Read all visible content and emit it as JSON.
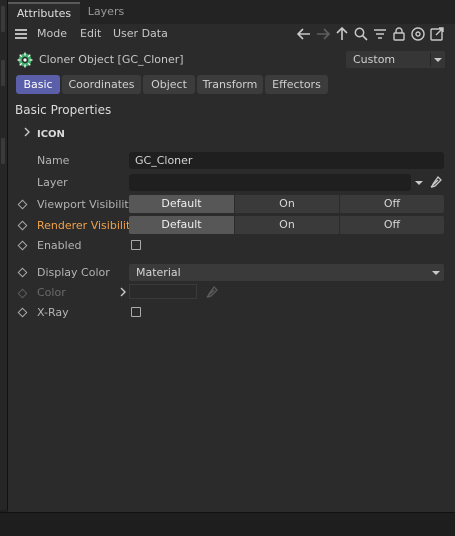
{
  "tabs": [
    {
      "label": "Attributes",
      "active": true
    },
    {
      "label": "Layers",
      "active": false
    }
  ],
  "menu": [
    "Mode",
    "Edit",
    "User Data"
  ],
  "object": {
    "title": "Cloner Object [GC_Cloner]",
    "preset": "Custom"
  },
  "subtabs": [
    {
      "label": "Basic",
      "active": true
    },
    {
      "label": "Coordinates",
      "active": false
    },
    {
      "label": "Object",
      "active": false
    },
    {
      "label": "Transform",
      "active": false
    },
    {
      "label": "Effectors",
      "active": false
    }
  ],
  "section_title": "Basic Properties",
  "group_title": "ICON",
  "fields": {
    "name_label": "Name",
    "name_value": "GC_Cloner",
    "layer_label": "Layer",
    "layer_value": "",
    "viewport_label": "Viewport Visibility",
    "renderer_label": "Renderer Visibility",
    "visibility_options": [
      "Default",
      "On",
      "Off"
    ],
    "viewport_selected": "Default",
    "renderer_selected": "Default",
    "enabled_label": "Enabled",
    "enabled_checked": false,
    "display_color_label": "Display Color",
    "display_color_value": "Material",
    "color_label": "Color",
    "xray_label": "X-Ray",
    "xray_checked": false
  },
  "colors": {
    "accent_tab": "#5b5faa",
    "highlight_label": "#f2a24a",
    "panel_bg": "#2b2b2b"
  },
  "icons": [
    "menu-icon",
    "back-arrow-icon",
    "forward-arrow-icon",
    "up-arrow-icon",
    "search-icon",
    "filter-icon",
    "lock-icon",
    "target-icon",
    "open-window-icon",
    "cloner-icon",
    "chevron-right-icon",
    "eyedropper-icon",
    "dropdown-caret-icon"
  ]
}
